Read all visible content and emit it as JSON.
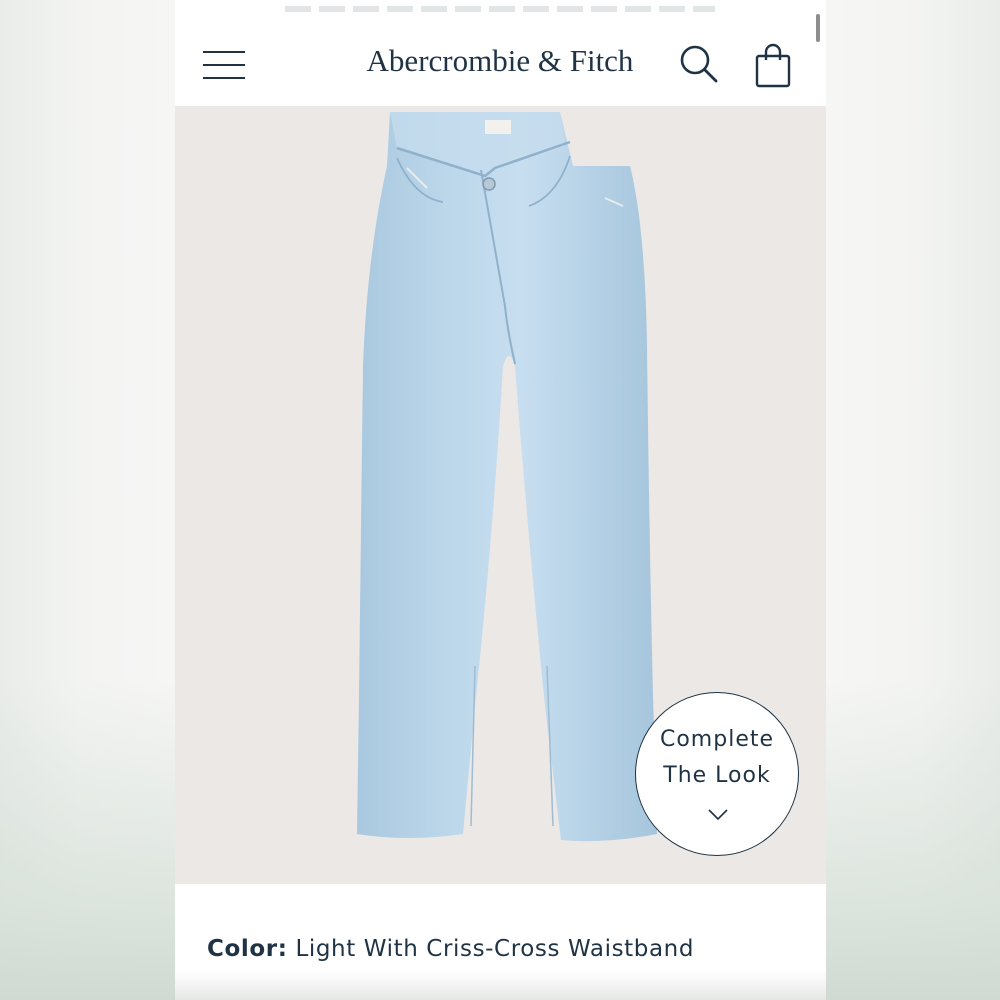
{
  "header": {
    "brand": "Abercrombie & Fitch",
    "menu_icon": "hamburger-menu-icon",
    "search_icon": "search-icon",
    "bag_icon": "shopping-bag-icon"
  },
  "product": {
    "image_alt": "light wash jeans with criss-cross waistband",
    "denim_color": "#b7d3e7"
  },
  "complete_the_look": {
    "line1": "Complete",
    "line2": "The Look",
    "icon": "chevron-down-icon"
  },
  "color": {
    "label": "Color:",
    "value": "Light With Criss-Cross Waistband"
  },
  "colors": {
    "navy": "#1f3345",
    "image_bg": "#ebe8e5"
  }
}
